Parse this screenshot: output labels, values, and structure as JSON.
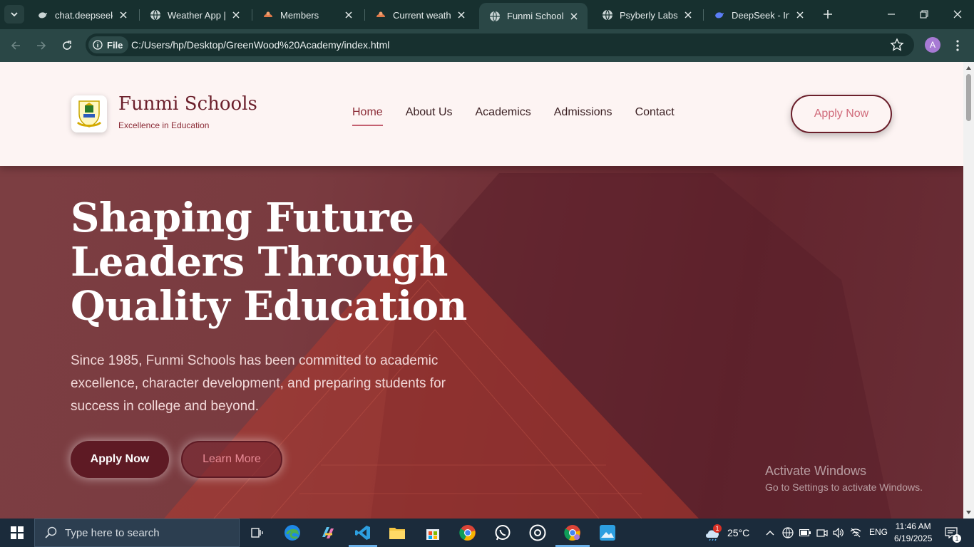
{
  "browser": {
    "tabs": [
      {
        "label": "chat.deepseek.com",
        "icon": "deepseek-icon"
      },
      {
        "label": "Weather App | Explore",
        "icon": "globe-icon"
      },
      {
        "label": "Members",
        "icon": "app-icon"
      },
      {
        "label": "Current weather",
        "icon": "app-icon"
      },
      {
        "label": "Funmi School | Excellence",
        "icon": "globe-icon",
        "active": true
      },
      {
        "label": "Psyberly Labs | Home",
        "icon": "globe-icon"
      },
      {
        "label": "DeepSeek - Into the Unknown",
        "icon": "deepseek-icon"
      }
    ],
    "chip_label": "File",
    "url": "C:/Users/hp/Desktop/GreenWood%20Academy/index.html",
    "profile_initial": "A"
  },
  "site": {
    "brand_name": "Funmi Schools",
    "brand_tagline": "Excellence in Education",
    "nav": [
      "Home",
      "About Us",
      "Academics",
      "Admissions",
      "Contact"
    ],
    "apply_button": "Apply Now"
  },
  "hero": {
    "title": "Shaping Future Leaders Through Quality Education",
    "text": "Since 1985, Funmi Schools has been committed to academic excellence, character development, and preparing students for success in college and beyond.",
    "primary_button": "Apply Now",
    "secondary_button": "Learn More"
  },
  "watermark": {
    "line1": "Activate Windows",
    "line2": "Go to Settings to activate Windows."
  },
  "taskbar": {
    "search_placeholder": "Type here to search",
    "weather": "25°C",
    "weather_badge": "1",
    "language": "ENG",
    "time": "11:46 AM",
    "date": "6/19/2025",
    "notification_count": "1"
  },
  "colors": {
    "brand": "#6b1f2b",
    "header_bg": "#fdf4f3",
    "hero_overlay": "#7a3b40",
    "chrome_dark": "#17302f"
  }
}
